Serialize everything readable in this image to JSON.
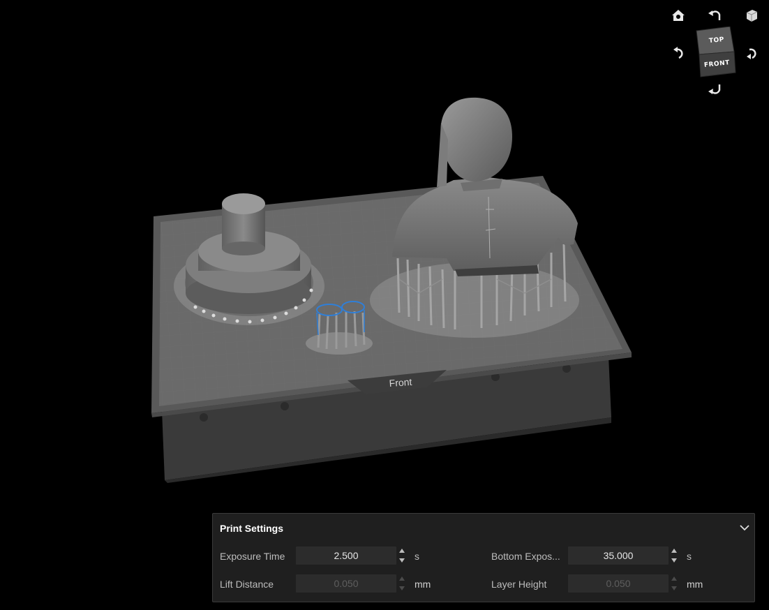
{
  "viewport": {
    "plate_label": "Front",
    "view_cube": {
      "top_face": "TOP",
      "front_face": "FRONT"
    },
    "nav_icons": [
      "home-icon",
      "undo-rotate-icon",
      "perspective-cube-icon",
      "rotate-left-icon",
      "rotate-right-icon",
      "rotate-down-icon"
    ]
  },
  "print_settings": {
    "title": "Print Settings",
    "exposure_time": {
      "label": "Exposure Time",
      "value": "2.500",
      "unit": "s",
      "enabled": true
    },
    "bottom_exposure": {
      "label": "Bottom Expos...",
      "value": "35.000",
      "unit": "s",
      "enabled": true
    },
    "lift_distance": {
      "label": "Lift Distance",
      "value": "0.050",
      "unit": "mm",
      "enabled": false
    },
    "layer_height": {
      "label": "Layer Height",
      "value": "0.050",
      "unit": "mm",
      "enabled": false
    }
  },
  "colors": {
    "background": "#000000",
    "plate": "#5c5c5c",
    "model": "#7a7a7a",
    "selection": "#2f7fd8",
    "panel": "#1f1f1f"
  }
}
